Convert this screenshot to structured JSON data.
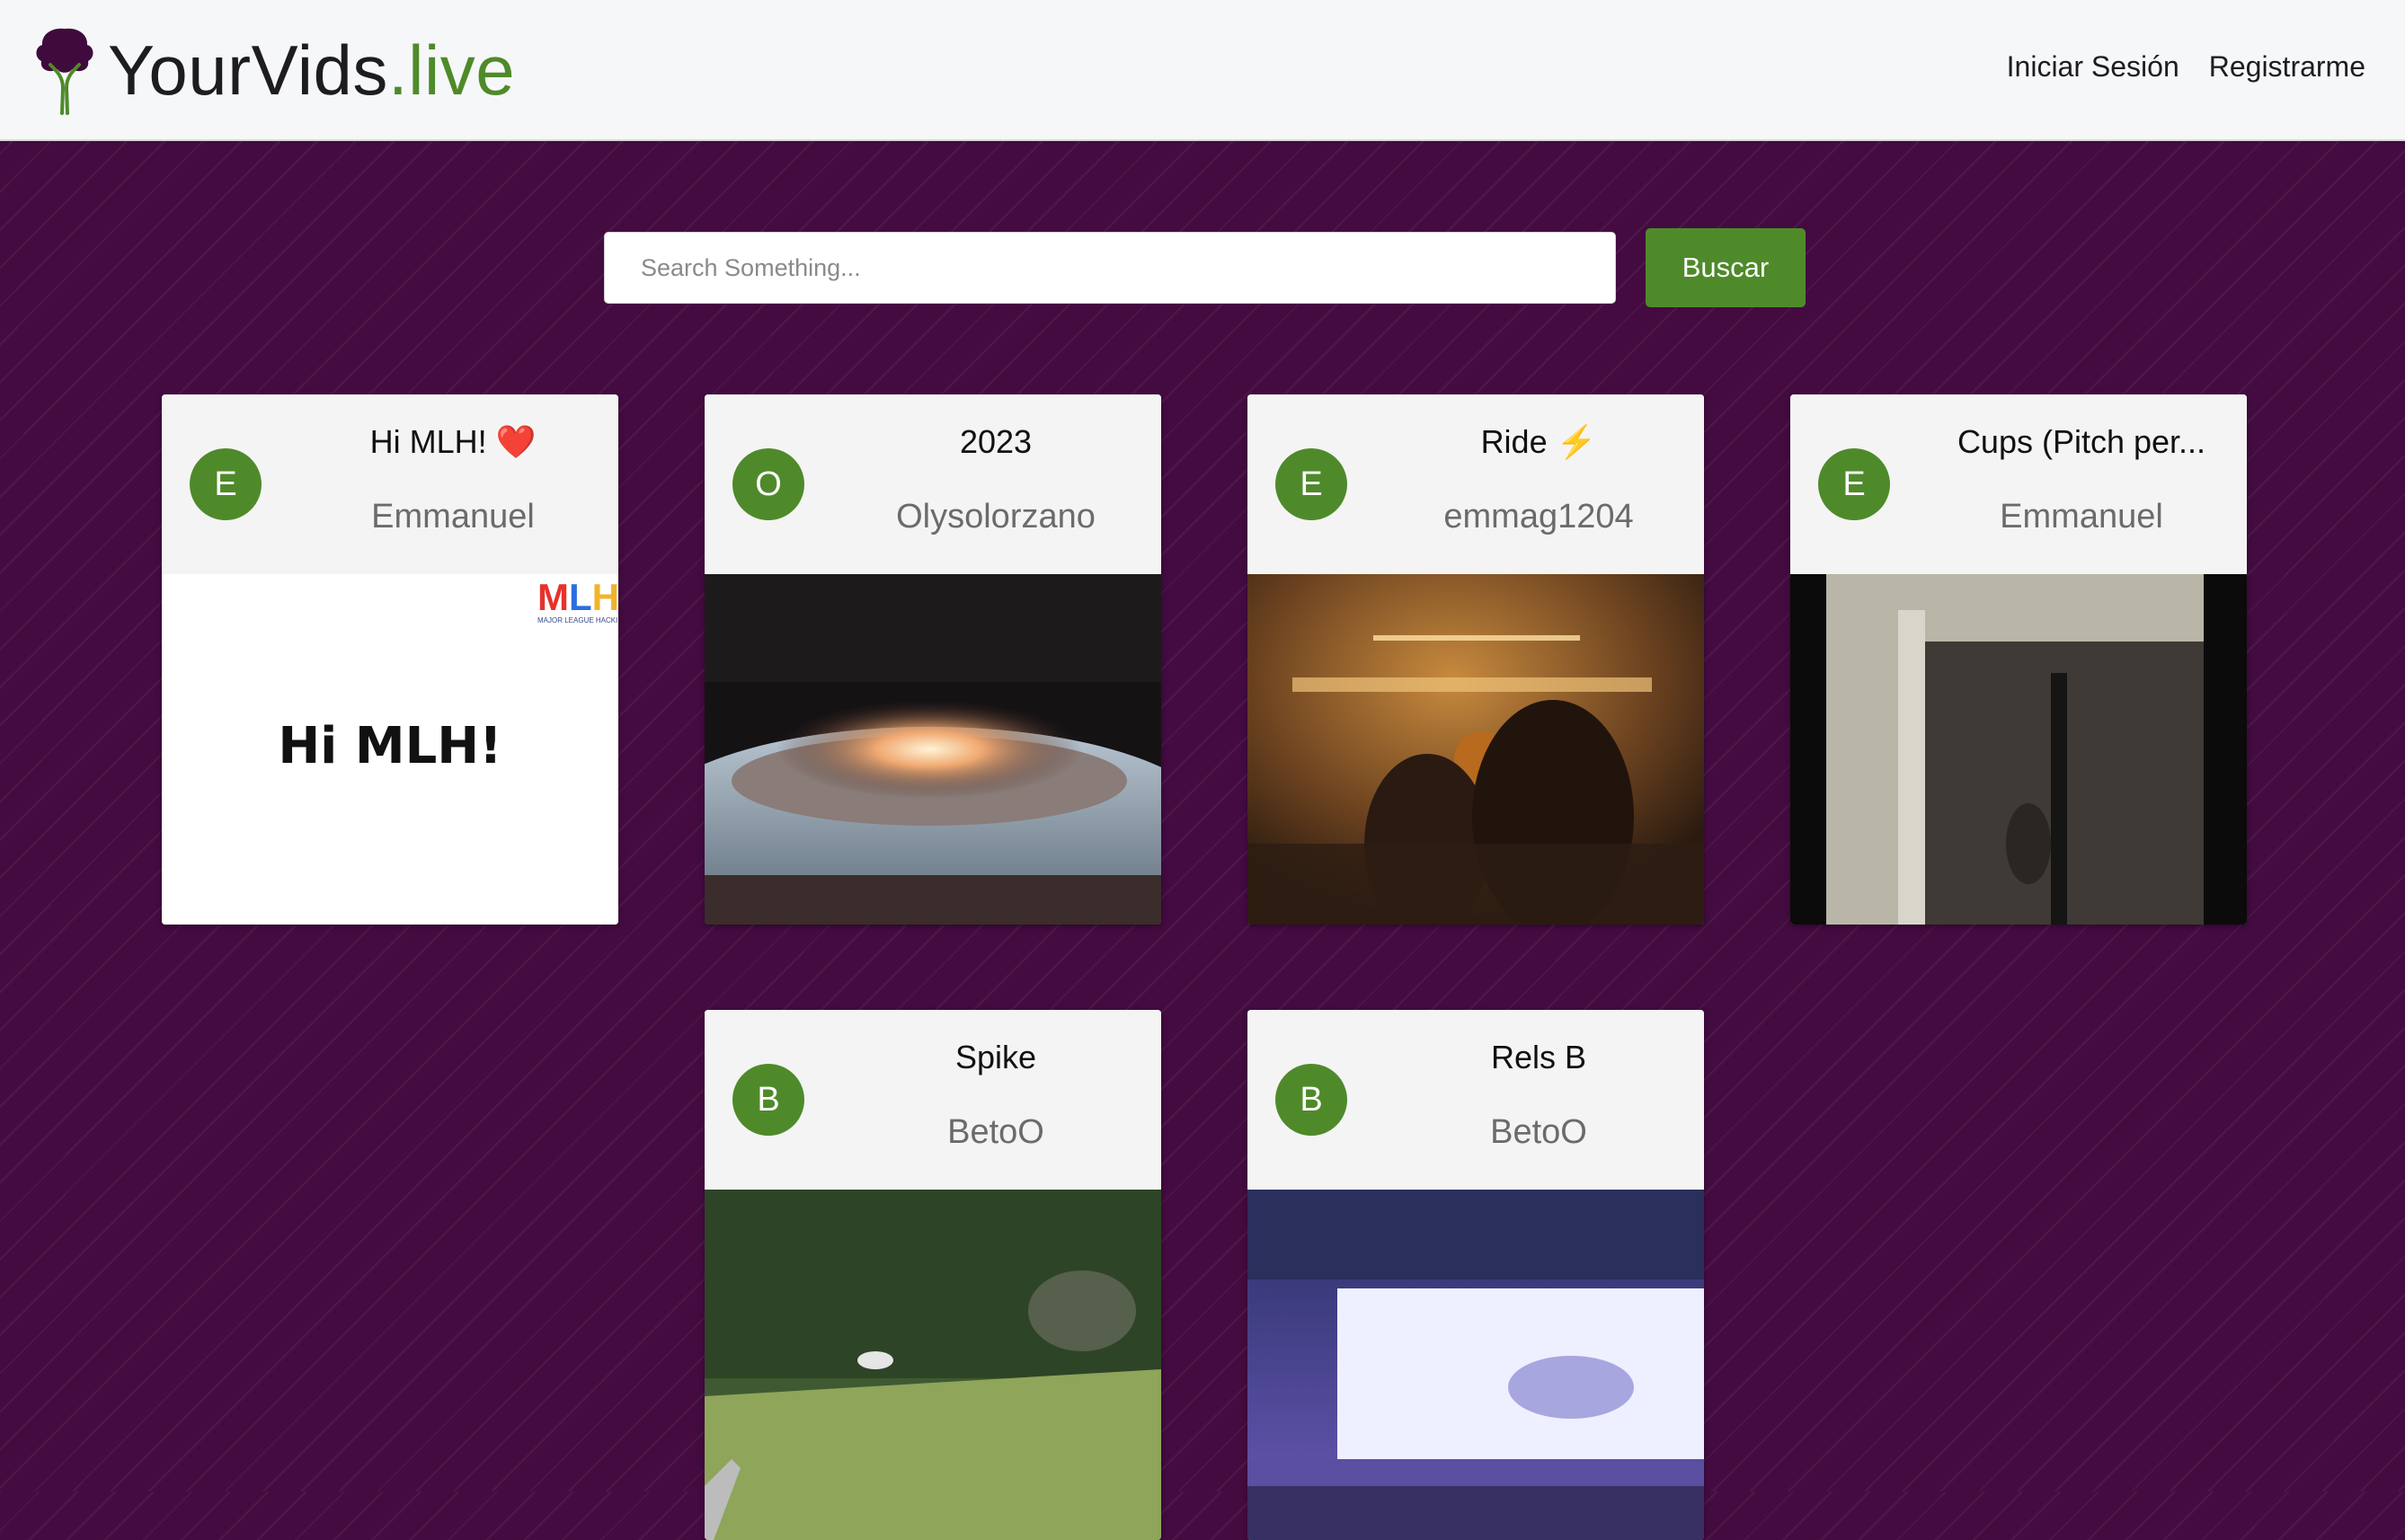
{
  "app": {
    "brand_name": "YourVids",
    "brand_tld": ".live",
    "accent_color": "#4f8a2a",
    "background_color": "#430b40"
  },
  "nav": {
    "login": "Iniciar Sesión",
    "register": "Registrarme"
  },
  "search": {
    "placeholder": "Search Something...",
    "button_label": "Buscar"
  },
  "videos": [
    {
      "title": "Hi MLH! ❤️",
      "author": "Emmanuel",
      "initial": "E",
      "thumb_text": "Hi MLH!",
      "thumb_logo": "MLH",
      "thumb_logo_sub": "MAJOR LEAGUE HACKING"
    },
    {
      "title": "2023",
      "author": "Olysolorzano",
      "initial": "O"
    },
    {
      "title": "Ride ⚡",
      "author": "emmag1204",
      "initial": "E"
    },
    {
      "title": "Cups (Pitch per...",
      "author": "Emmanuel",
      "initial": "E"
    },
    {
      "title": "Spike",
      "author": "BetoO",
      "initial": "B"
    },
    {
      "title": "Rels B",
      "author": "BetoO",
      "initial": "B"
    }
  ]
}
